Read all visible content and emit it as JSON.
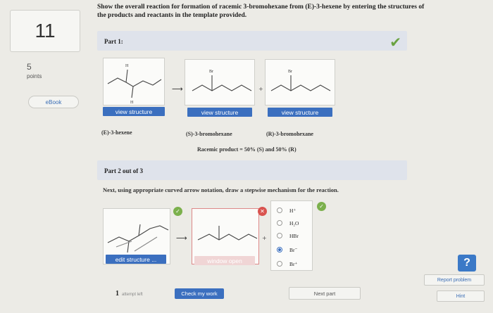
{
  "sidebar": {
    "question_number": "11",
    "points_value": "5",
    "points_label": "points",
    "ebook_label": "eBook"
  },
  "question": {
    "text": "Show the overall reaction for formation of racemic 3-bromohexane from (E)-3-hexene by entering the structures of the products and reactants in the template provided."
  },
  "part1": {
    "title": "Part 1:",
    "status_icon": "check-icon",
    "structures": [
      {
        "button_label": "view structure",
        "name": "(E)-3-hexene",
        "atom_top": "H",
        "atom_bottom": "H"
      },
      {
        "button_label": "view structure",
        "name": "(S)-3-bromohexane",
        "atom_top": "Br"
      },
      {
        "button_label": "view structure",
        "name": "(R)-3-bromohexane",
        "atom_top": "Br"
      }
    ],
    "plus_sign": "+",
    "racemic_text": "Racemic product = 50% (S) and 50% (R)"
  },
  "part2": {
    "title": "Part 2 out of 3",
    "instruction": "Next, using appropriate curved arrow notation, draw a stepwise mechanism for the reaction.",
    "edit_button_label": "edit structure ...",
    "window_button_label": "window open",
    "plus_sign": "+",
    "reagent_options": [
      {
        "label": "H⁺",
        "selected": false
      },
      {
        "label": "H₂O",
        "selected": false
      },
      {
        "label": "HBr",
        "selected": false
      },
      {
        "label": "Br⁻",
        "selected": true
      },
      {
        "label": "Br⁺",
        "selected": false
      }
    ]
  },
  "footer": {
    "attempts_count": "1",
    "attempts_label": "attempt left",
    "check_work_label": "Check my work",
    "next_part_label": "Next part",
    "report_label": "Report problem",
    "hint_label": "Hint",
    "help_label": "?"
  },
  "colors": {
    "accent_blue": "#3b6fbf",
    "success_green": "#6aa341",
    "error_red": "#d9534f",
    "banner": "#dfe3eb"
  }
}
